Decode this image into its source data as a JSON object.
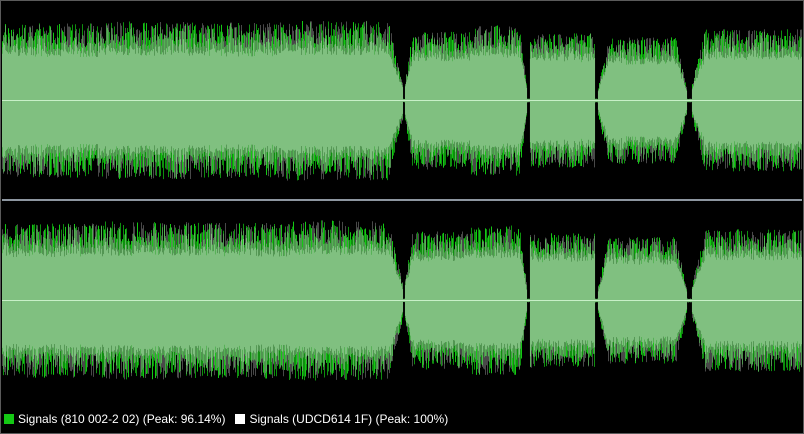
{
  "colors": {
    "background": "#000000",
    "signal_a": "#14c814",
    "signal_a_dark": "#0e8f0e",
    "signal_b": "#ffffff",
    "signal_b_dim": "#9a9a9a",
    "overlap_fill": "#80c080",
    "center_line": "#c8f0c8"
  },
  "channels": [
    {
      "name": "top"
    },
    {
      "name": "bottom"
    }
  ],
  "segments": [
    {
      "start": 0.0,
      "end": 0.127,
      "level": 0.78
    },
    {
      "start": 0.127,
      "end": 0.24,
      "level": 0.8
    },
    {
      "start": 0.24,
      "end": 0.355,
      "level": 0.79
    },
    {
      "start": 0.355,
      "end": 0.5,
      "level": 0.81,
      "fade_out": true
    },
    {
      "start": 0.503,
      "end": 0.585,
      "level": 0.7,
      "fade_in": true
    },
    {
      "start": 0.585,
      "end": 0.655,
      "level": 0.76,
      "fade_out": true
    },
    {
      "start": 0.66,
      "end": 0.74,
      "level": 0.68
    },
    {
      "start": 0.745,
      "end": 0.855,
      "level": 0.64,
      "fade_in": true,
      "fade_out": true
    },
    {
      "start": 0.862,
      "end": 1.0,
      "level": 0.72,
      "fade_in": true
    }
  ],
  "legend": [
    {
      "label": "Signals (810 002-2 02) (Peak: 96.14%)",
      "color": "#14c814"
    },
    {
      "label": "Signals (UDCD614 1F) (Peak: 100%)",
      "color": "#ffffff"
    }
  ]
}
